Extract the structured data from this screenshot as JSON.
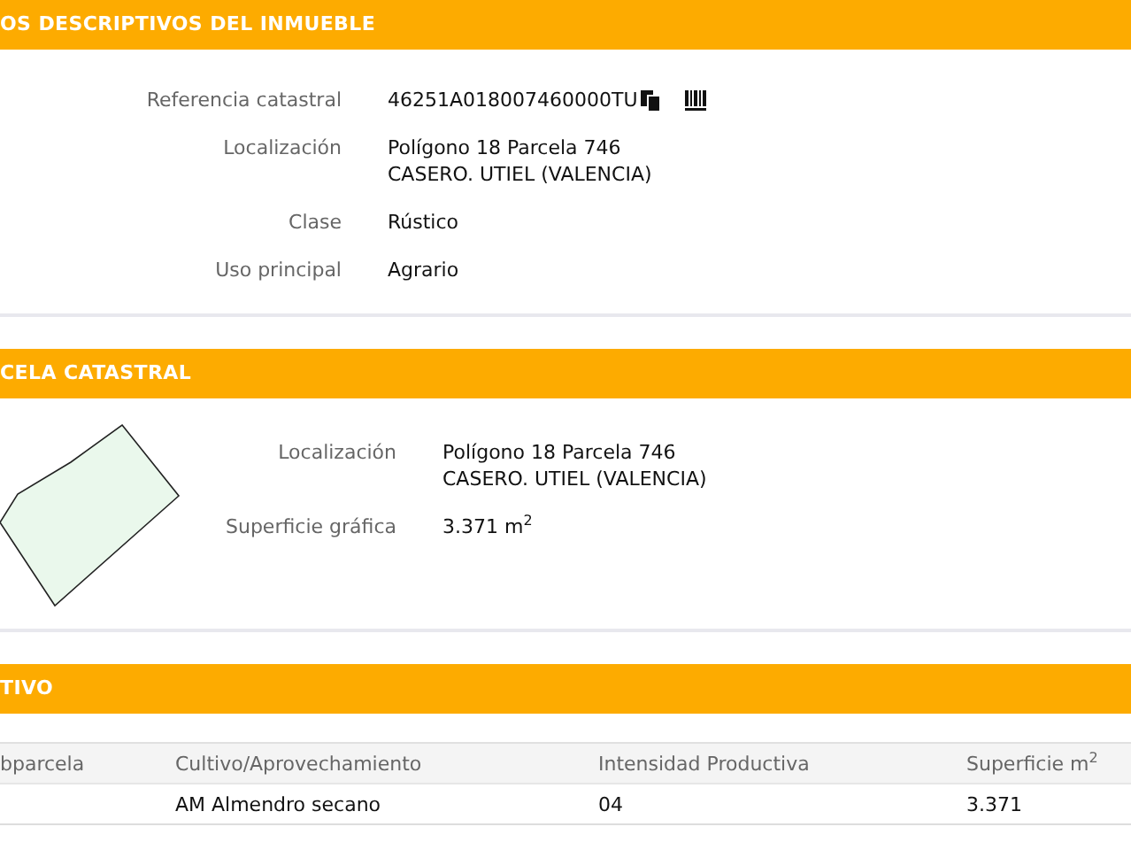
{
  "sections": [
    {
      "title": "OS DESCRIPTIVOS DEL INMUEBLE",
      "kind": "fields",
      "fields": [
        {
          "label": "Referencia catastral",
          "lines": [
            "46251A018007460000TU"
          ],
          "kind": "reference"
        },
        {
          "label": "Localización",
          "lines": [
            "Polígono 18 Parcela 746",
            "CASERO. UTIEL (VALENCIA)"
          ],
          "kind": "text"
        },
        {
          "label": "Clase",
          "lines": [
            "Rústico"
          ],
          "kind": "text"
        },
        {
          "label": "Uso principal",
          "lines": [
            "Agrario"
          ],
          "kind": "text"
        }
      ]
    },
    {
      "title": "CELA CATASTRAL",
      "kind": "parcel",
      "fields": [
        {
          "label": "Localización",
          "lines": [
            "Polígono 18 Parcela 746",
            "CASERO. UTIEL (VALENCIA)"
          ],
          "kind": "text"
        },
        {
          "label": "Superficie gráfica",
          "lines": [
            "3.371 m$^{2}$"
          ],
          "kind": "text"
        }
      ]
    },
    {
      "title": "TIVO",
      "kind": "table",
      "columns": [
        "bparcela",
        "Cultivo/Aprovechamiento",
        "Intensidad Productiva",
        "Superficie m$^{2}$"
      ],
      "rows": [
        [
          "",
          "AM Almendro secano",
          "04",
          "3.371"
        ]
      ]
    }
  ]
}
